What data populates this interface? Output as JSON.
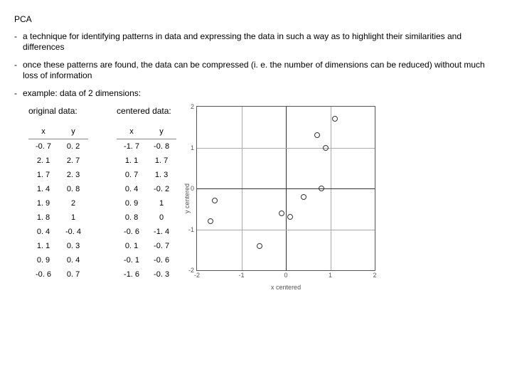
{
  "title": "PCA",
  "bullets": [
    "a technique for identifying patterns in data and expressing the data in such a way as to highlight their similarities and differences",
    "once these patterns are found, the data can be compressed (i. e. the number of dimensions can be reduced) without much loss of information",
    "example: data of 2 dimensions:"
  ],
  "tables": {
    "original": {
      "caption": "original data:",
      "headers": [
        "x",
        "y"
      ],
      "rows": [
        [
          "-0. 7",
          "0. 2"
        ],
        [
          "2. 1",
          "2. 7"
        ],
        [
          "1. 7",
          "2. 3"
        ],
        [
          "1. 4",
          "0. 8"
        ],
        [
          "1. 9",
          "2"
        ],
        [
          "1. 8",
          "1"
        ],
        [
          "0. 4",
          "-0. 4"
        ],
        [
          "1. 1",
          "0. 3"
        ],
        [
          "0. 9",
          "0. 4"
        ],
        [
          "-0. 6",
          "0. 7"
        ]
      ]
    },
    "centered": {
      "caption": "centered data:",
      "headers": [
        "x",
        "y"
      ],
      "rows": [
        [
          "-1. 7",
          "-0. 8"
        ],
        [
          "1. 1",
          "1. 7"
        ],
        [
          "0. 7",
          "1. 3"
        ],
        [
          "0. 4",
          "-0. 2"
        ],
        [
          "0. 9",
          "1"
        ],
        [
          "0. 8",
          "0"
        ],
        [
          "-0. 6",
          "-1. 4"
        ],
        [
          "0. 1",
          "-0. 7"
        ],
        [
          "-0. 1",
          "-0. 6"
        ],
        [
          "-1. 6",
          "-0. 3"
        ]
      ]
    }
  },
  "chart_data": {
    "type": "scatter",
    "title": "",
    "xlabel": "x centered",
    "ylabel": "y centered",
    "xlim": [
      -2,
      2
    ],
    "ylim": [
      -2,
      2
    ],
    "xticks": [
      -2,
      -1,
      0,
      1,
      2
    ],
    "yticks": [
      -2,
      -1,
      0,
      1,
      2
    ],
    "series": [
      {
        "name": "centered",
        "points": [
          {
            "x": -1.7,
            "y": -0.8
          },
          {
            "x": 1.1,
            "y": 1.7
          },
          {
            "x": 0.7,
            "y": 1.3
          },
          {
            "x": 0.4,
            "y": -0.2
          },
          {
            "x": 0.9,
            "y": 1.0
          },
          {
            "x": 0.8,
            "y": 0.0
          },
          {
            "x": -0.6,
            "y": -1.4
          },
          {
            "x": 0.1,
            "y": -0.7
          },
          {
            "x": -0.1,
            "y": -0.6
          },
          {
            "x": -1.6,
            "y": -0.3
          }
        ]
      }
    ]
  }
}
